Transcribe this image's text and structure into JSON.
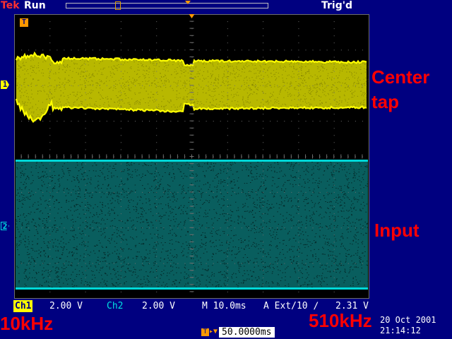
{
  "header": {
    "brand_t": "T",
    "brand_rest": "ek",
    "run_state": "Run",
    "trigger_state": "Trig'd",
    "record_window_fraction": 0.24,
    "trigger_position_fraction": 0.6
  },
  "screen": {
    "ch1_marker": "1",
    "ch2_marker": "2",
    "trigger_corner": "T",
    "colors": {
      "background": "#000000",
      "grid": "#6e6e6e",
      "ch1": "#ffff00",
      "ch2": "#00d8d8"
    }
  },
  "status": {
    "ch1_label": "Ch1",
    "ch1_scale": "2.00 V",
    "ch2_label": "Ch2",
    "ch2_scale": "2.00 V",
    "horizontal_scale": "M 10.0ms",
    "trigger_source": "A Ext/10 ∕",
    "trigger_level": "2.31 V"
  },
  "horizontal_position": {
    "icon": "T",
    "arrow": "▸▼",
    "value": "50.0000ms"
  },
  "datetime": {
    "date": "20 Oct  2001",
    "time": "21:14:12"
  },
  "annotations": {
    "center_line1": "Center",
    "center_line2": "tap",
    "input": "Input",
    "start_freq": "10kHz",
    "end_freq": "510kHz"
  }
}
